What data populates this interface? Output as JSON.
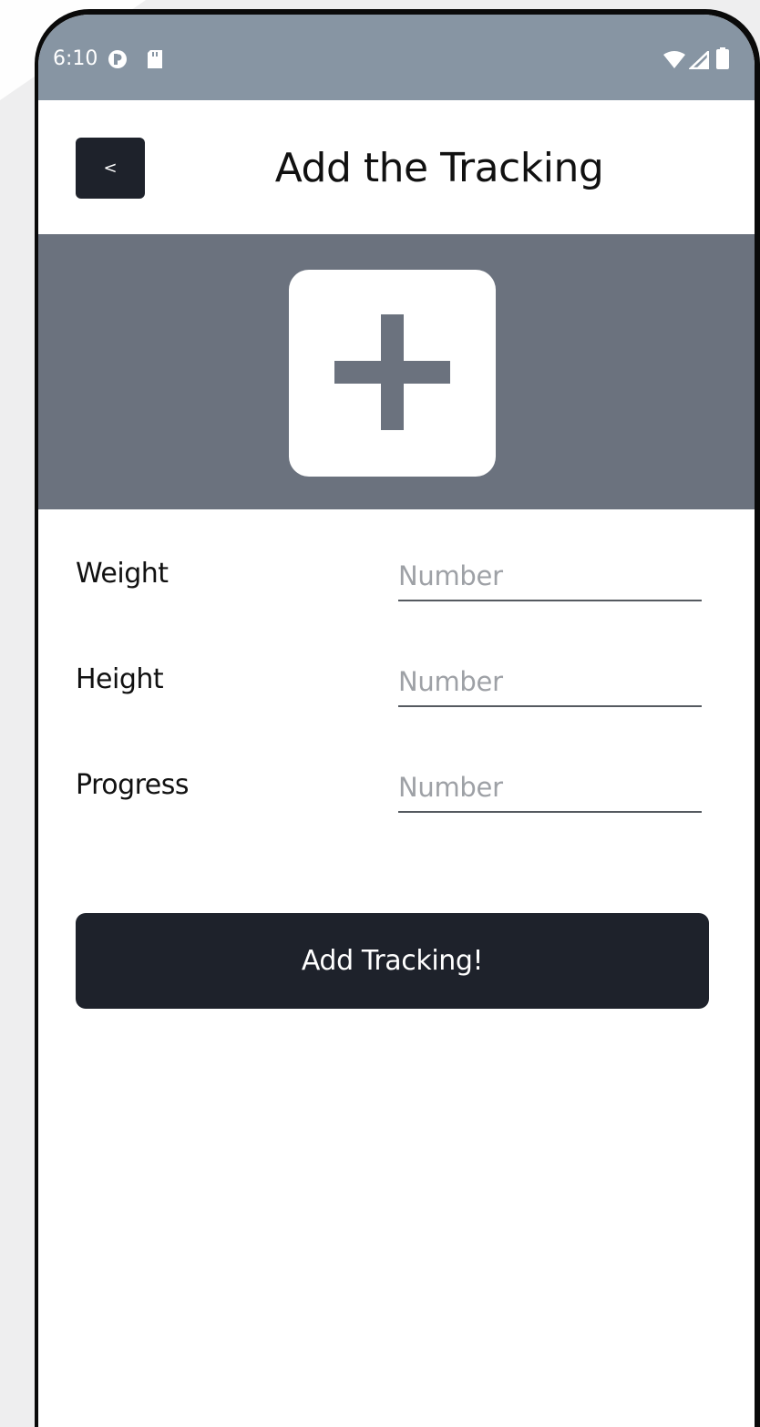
{
  "status_bar": {
    "time": "6:10",
    "left_icons": [
      "app-notification-icon",
      "sd-card-icon"
    ],
    "right_icons": [
      "wifi-icon",
      "signal-icon",
      "battery-icon"
    ]
  },
  "header": {
    "back_label": "<",
    "title": "Add the Tracking"
  },
  "banner": {
    "icon": "plus-icon"
  },
  "form": {
    "fields": [
      {
        "label": "Weight",
        "placeholder": "Number",
        "value": ""
      },
      {
        "label": "Height",
        "placeholder": "Number",
        "value": ""
      },
      {
        "label": "Progress",
        "placeholder": "Number",
        "value": ""
      }
    ],
    "submit_label": "Add Tracking!"
  },
  "colors": {
    "status_bar": "#8795a3",
    "banner": "#6b727e",
    "primary_dark": "#1e222b",
    "background": "#ffffff"
  }
}
